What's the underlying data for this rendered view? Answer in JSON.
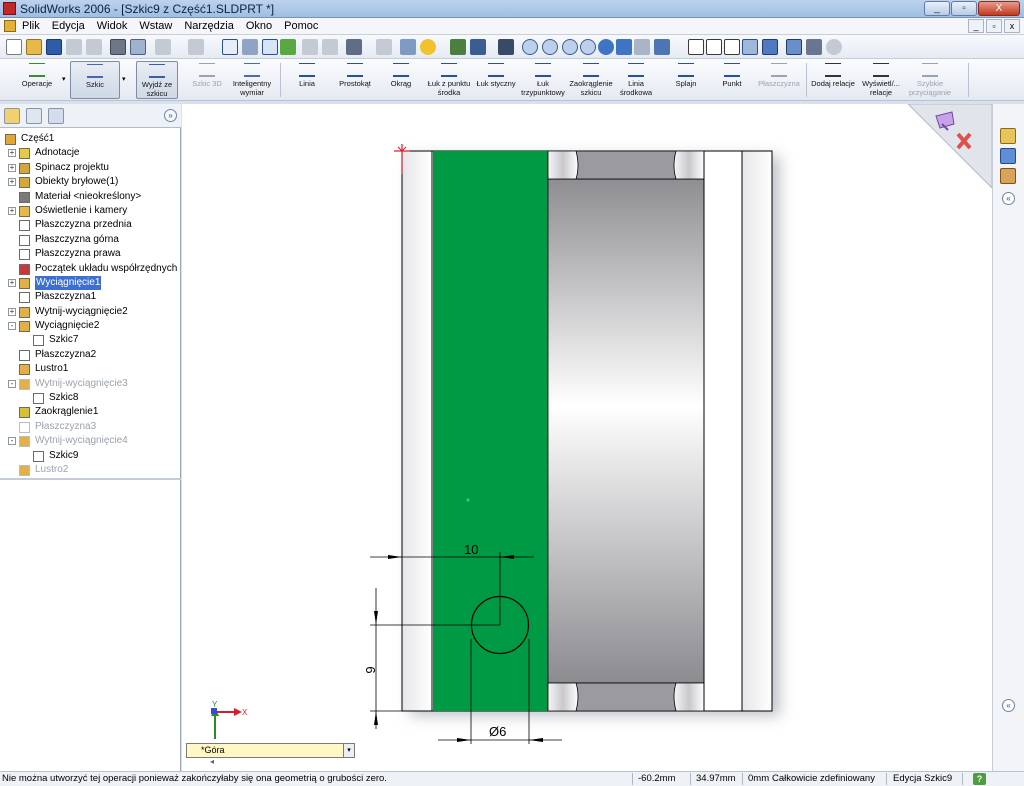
{
  "window": {
    "title": "SolidWorks 2006 - [Szkic9 z Część1.SLDPRT *]",
    "buttons": [
      "_",
      "▫",
      "X"
    ]
  },
  "menu": {
    "items": [
      "Plik",
      "Edycja",
      "Widok",
      "Wstaw",
      "Narzędzia",
      "Okno",
      "Pomoc"
    ],
    "right_buttons": [
      "_",
      "▫",
      "x"
    ]
  },
  "command_manager": {
    "items": [
      {
        "label": "Operacje",
        "icon": "features-icon",
        "state": "normal"
      },
      {
        "label": "Szkic",
        "icon": "sketch-icon",
        "state": "active"
      },
      {
        "label": "Wyjdź ze szkicu",
        "icon": "exit-sketch-icon",
        "state": "active"
      },
      {
        "label": "Szkic 3D",
        "icon": "sketch-3d-icon",
        "state": "disabled"
      },
      {
        "label": "Inteligentny wymiar",
        "icon": "smart-dimension-icon",
        "state": "normal"
      },
      {
        "label": "Linia",
        "icon": "line-icon",
        "state": "normal"
      },
      {
        "label": "Prostokąt",
        "icon": "rectangle-icon",
        "state": "normal"
      },
      {
        "label": "Okrąg",
        "icon": "circle-icon",
        "state": "normal"
      },
      {
        "label": "Łuk z punktu środka",
        "icon": "centerpoint-arc-icon",
        "state": "normal"
      },
      {
        "label": "Łuk styczny",
        "icon": "tangent-arc-icon",
        "state": "normal"
      },
      {
        "label": "Łuk trzypunktowy",
        "icon": "three-point-arc-icon",
        "state": "normal"
      },
      {
        "label": "Zaokrąglenie szkicu",
        "icon": "sketch-fillet-icon",
        "state": "normal"
      },
      {
        "label": "Linia środkowa",
        "icon": "centerline-icon",
        "state": "normal"
      },
      {
        "label": "Splajn",
        "icon": "spline-icon",
        "state": "normal"
      },
      {
        "label": "Punkt",
        "icon": "point-icon",
        "state": "normal"
      },
      {
        "label": "Płaszczyzna",
        "icon": "plane-icon",
        "state": "disabled"
      },
      {
        "label": "Dodaj relacje",
        "icon": "add-relation-icon",
        "state": "normal"
      },
      {
        "label": "Wyświetl/... relacje",
        "icon": "display-relations-icon",
        "state": "normal"
      },
      {
        "label": "Szybkie przyciąganie",
        "icon": "quick-snaps-icon",
        "state": "disabled"
      }
    ]
  },
  "feature_tree": {
    "items": [
      {
        "label": "Część1",
        "icon": "part-icon",
        "level": 0,
        "expander": "",
        "state": "normal"
      },
      {
        "label": "Adnotacje",
        "icon": "annotations-icon",
        "level": 1,
        "expander": "+",
        "state": "normal"
      },
      {
        "label": "Spinacz projektu",
        "icon": "design-binder-icon",
        "level": 1,
        "expander": "+",
        "state": "normal"
      },
      {
        "label": "Obiekty bryłowe(1)",
        "icon": "solid-bodies-icon",
        "level": 1,
        "expander": "+",
        "state": "normal"
      },
      {
        "label": "Materiał <nieokreślony>",
        "icon": "material-icon",
        "level": 1,
        "expander": "",
        "state": "normal"
      },
      {
        "label": "Oświetlenie i kamery",
        "icon": "lights-cameras-icon",
        "level": 1,
        "expander": "+",
        "state": "normal"
      },
      {
        "label": "Płaszczyzna przednia",
        "icon": "plane-icon",
        "level": 1,
        "expander": "",
        "state": "normal"
      },
      {
        "label": "Płaszczyzna górna",
        "icon": "plane-icon",
        "level": 1,
        "expander": "",
        "state": "normal"
      },
      {
        "label": "Płaszczyzna prawa",
        "icon": "plane-icon",
        "level": 1,
        "expander": "",
        "state": "normal"
      },
      {
        "label": "Początek układu współrzędnych",
        "icon": "origin-icon",
        "level": 1,
        "expander": "",
        "state": "normal"
      },
      {
        "label": "Wyciągnięcie1",
        "icon": "extrude-icon",
        "level": 1,
        "expander": "+",
        "state": "selected"
      },
      {
        "label": "Płaszczyzna1",
        "icon": "plane-icon",
        "level": 1,
        "expander": "",
        "state": "normal"
      },
      {
        "label": "Wytnij-wyciągnięcie2",
        "icon": "cut-extrude-icon",
        "level": 1,
        "expander": "+",
        "state": "normal"
      },
      {
        "label": "Wyciągnięcie2",
        "icon": "extrude-icon",
        "level": 1,
        "expander": "-",
        "state": "normal"
      },
      {
        "label": "Szkic7",
        "icon": "sketch-icon",
        "level": 2,
        "expander": "",
        "state": "normal"
      },
      {
        "label": "Płaszczyzna2",
        "icon": "plane-icon",
        "level": 1,
        "expander": "",
        "state": "normal"
      },
      {
        "label": "Lustro1",
        "icon": "mirror-icon",
        "level": 1,
        "expander": "",
        "state": "normal"
      },
      {
        "label": "Wytnij-wyciągnięcie3",
        "icon": "cut-extrude-icon",
        "level": 1,
        "expander": "-",
        "state": "dim"
      },
      {
        "label": "Szkic8",
        "icon": "sketch-icon",
        "level": 2,
        "expander": "",
        "state": "normal"
      },
      {
        "label": "Zaokrąglenie1",
        "icon": "fillet-icon",
        "level": 1,
        "expander": "",
        "state": "normal"
      },
      {
        "label": "Płaszczyzna3",
        "icon": "plane-icon",
        "level": 1,
        "expander": "",
        "state": "dim"
      },
      {
        "label": "Wytnij-wyciągnięcie4",
        "icon": "cut-extrude-icon",
        "level": 1,
        "expander": "-",
        "state": "dim"
      },
      {
        "label": "Szkic9",
        "icon": "sketch-icon",
        "level": 2,
        "expander": "",
        "state": "normal"
      },
      {
        "label": "Lustro2",
        "icon": "mirror-icon",
        "level": 1,
        "expander": "",
        "state": "dim"
      }
    ]
  },
  "dimensions": {
    "horizontal": "10",
    "vertical": "9",
    "diameter": "Ø6"
  },
  "view": {
    "orientation": "*Góra",
    "axis_x": "X",
    "axis_y": "Y"
  },
  "colors": {
    "selected_face": "#009a44",
    "sketch_line": "#000000",
    "selection_highlight": "#3d6fd1",
    "view_box": "#fff7c4"
  },
  "status": {
    "message": "Nie można utworzyć tej operacji ponieważ zakończyłaby się ona geometrią o grubości zero.",
    "x": "-60.2mm",
    "y": "34.97mm",
    "z": "0mm",
    "definition": "Całkowicie zdefiniowany",
    "mode": "Edycja Szkic9",
    "help": "?"
  }
}
